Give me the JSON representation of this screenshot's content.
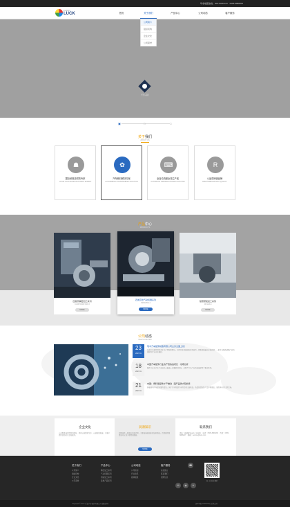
{
  "topbar": {
    "hotline": "华北地区热线：400-1008-123　0595-8888206"
  },
  "logo": {
    "small": "LUCKY",
    "big": "LUCK"
  },
  "nav": [
    {
      "label": "首页"
    },
    {
      "label": "关于我们"
    },
    {
      "label": "产品中心"
    },
    {
      "label": "公司动态"
    },
    {
      "label": "客户服务"
    }
  ],
  "dropdown": [
    "公司简介",
    "组织机构",
    "企业文化",
    "公司荣誉"
  ],
  "banner": {
    "caption": "乐凯·品质"
  },
  "slider": [
    "1",
    "2",
    "3"
  ],
  "about": {
    "title_a": "关于",
    "title_b": "我们",
    "sub": "ABOUT US",
    "cards": [
      {
        "cn": "国际闭离涂附的专家",
        "en": "CUSIN LINTS MANUFACTURING EXPERT",
        "icon": "☗"
      },
      {
        "cn": "汽车耗材解决方案",
        "en": "AUTOMOBILE CONSUMABLES SOLUTION",
        "icon": "✿"
      },
      {
        "cn": "全自动流程全流生产线",
        "en": "AUTOMATIC GRINDING PRODUCTION LINE",
        "icon": "⌨"
      },
      {
        "cn": "以品质缔造品牌",
        "en": "CREATE BRAND WITH QUALITY",
        "icon": "R"
      }
    ]
  },
  "products": {
    "title_a": "产品",
    "title_b": "中心",
    "sub": "PRODUCTS",
    "items": [
      {
        "name": "四类高精密加工系列",
        "code": "CJ-MT3-W07-N07-3",
        "more": "MORE"
      },
      {
        "name": "四类高性气动机器系列",
        "code": "SM-NAT01-1",
        "more": "MORE"
      },
      {
        "name": "随意研拓加工系列",
        "code": "JK-NCA-3",
        "more": "MORE"
      }
    ]
  },
  "news": {
    "title_a": "公司",
    "title_b": "动态",
    "sub": "NEWS CENTER",
    "items": [
      {
        "day": "23",
        "month": "2017-01",
        "title": "瑞丰汽车配件制造有限公司业务全面上线！",
        "summary": "乐凯汽车配件经历多年生产经营积累后，已经完全具备国际竞争能力，销售网络遍布全国各地，一家专业制造研磨产品的国际性企业正在崛起。"
      },
      {
        "day": "18",
        "month": "2017-01",
        "title": "中国汽车配件行业的产值快速增长 · 市场分析",
        "summary": "配件行业在汽车产业链中占据着十分重要的地位，对整个汽车产业的发展起到了推动作用。"
      },
      {
        "day": "21",
        "month": "2017-01",
        "title": "中国：博科等配件扩产推动 · 国产品牌大有前景",
        "summary": "随着国内汽车保有量的增加，国产汽车零部件市场需求日益旺盛，各类新型配件产品不断推出，服务体系也日趋完善。"
      }
    ]
  },
  "three": [
    {
      "title": "企业文化",
      "text": "公司秉承诚信经营的理念，坚持以质量求生存、以创新谋发展，为客户提供优质的产品和服务。"
    },
    {
      "title": "润滑知识",
      "text": "润滑油是一种复杂的混合物，主要由基础油和添加剂组成，合理使用润滑油可以减少摩擦和磨损。",
      "btn": "MORE"
    },
    {
      "title": "联系我们",
      "text": "地址：福建省泉州市工业园区　电话：0595-8888206　传真：0595-8888207　邮箱：service@luck.com"
    }
  ],
  "footer": {
    "cols": [
      {
        "h": "关于我们",
        "items": [
          "公司简介",
          "组织机构",
          "企业文化",
          "公司荣誉"
        ]
      },
      {
        "h": "产品中心",
        "items": [
          "精密加工系列",
          "气动机器系列",
          "研拓加工系列",
          "其他产品系列"
        ]
      },
      {
        "h": "公司动态",
        "items": [
          "公司新闻",
          "行业资讯",
          "媒体报道"
        ]
      },
      {
        "h": "客户服务",
        "items": [
          "在线留言",
          "联系我们",
          "招聘信息"
        ]
      }
    ],
    "icons": [
      "☎",
      "✉",
      "◉",
      "✈",
      "♥"
    ],
    "qr_caption": "扫一扫关注我们",
    "tel": "0595-8888206",
    "copyright": "Copyright © 2017 乐凯汽车配件有限公司 版权所有",
    "record": "闽ICP备12345678号 技术支持"
  }
}
